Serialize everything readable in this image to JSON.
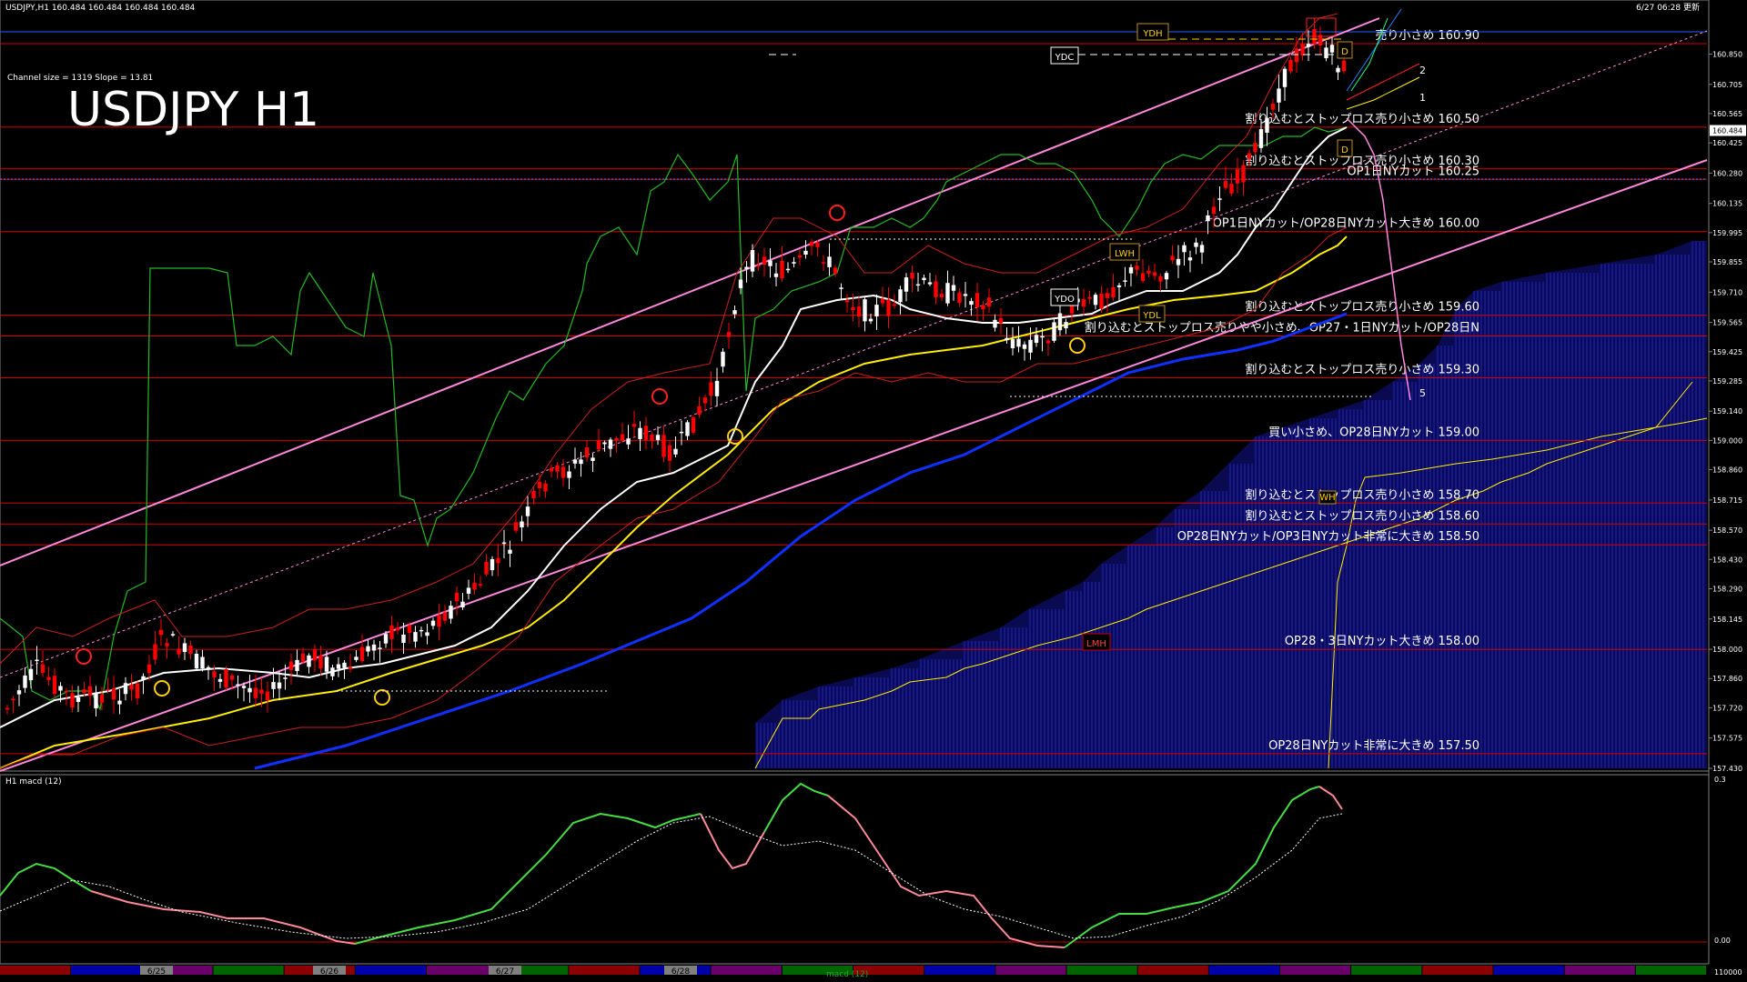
{
  "window": {
    "header": "USDJPY,H1  160.484 160.484 160.484 160.484",
    "updated": "6/27 06:28 更新",
    "symbol_title": "USDJPY H1",
    "channel_info": "Channel size = 1319  Slope = 13.81",
    "sub_label": "H1  macd (12)",
    "bottom_status": "macd (12)"
  },
  "colors": {
    "background": "#000000",
    "bull": "#ffffff",
    "bear": "#ff0000",
    "level_line": "#d40000",
    "channel": "#ff88dd",
    "macd_up": "#44dd44",
    "macd_down": "#ff8899",
    "kumo": "#2020c0",
    "ma_yellow": "#ffee00",
    "ma_blue": "#1030ff",
    "ma_white": "#ffffff",
    "green_line": "#22bb22"
  },
  "chart_data": {
    "type": "candlestick",
    "symbol": "USDJPY",
    "timeframe": "H1",
    "ylim": [
      157.43,
      161.0
    ],
    "y_ticks": [
      "160.850",
      "160.705",
      "160.565",
      "160.425",
      "160.280",
      "160.135",
      "159.995",
      "159.855",
      "159.710",
      "159.565",
      "159.425",
      "159.285",
      "159.140",
      "159.000",
      "158.860",
      "158.715",
      "158.570",
      "158.430",
      "158.290",
      "158.145",
      "158.000",
      "157.860",
      "157.720",
      "157.575",
      "157.430"
    ],
    "current_price": "160.484",
    "date_labels": [
      "6/25",
      "6/26",
      "6/27",
      "6/28"
    ],
    "levels": [
      {
        "price": 160.9,
        "label": "売り小さめ 160.90"
      },
      {
        "price": 160.5,
        "label": "割り込むとストップロス売り小さめ 160.50"
      },
      {
        "price": 160.3,
        "label": "割り込むとストップロス売り小さめ 160.30"
      },
      {
        "price": 160.25,
        "label": "OP1日NYカット 160.25"
      },
      {
        "price": 160.0,
        "label": "OP1日NYカット/OP28日NYカット大きめ 160.00"
      },
      {
        "price": 159.6,
        "label": "割り込むとストップロス売り小さめ 159.60"
      },
      {
        "price": 159.5,
        "label": "割り込むとストップロス売りやや小さめ、OP27・1日NYカット/OP28日N"
      },
      {
        "price": 159.3,
        "label": "割り込むとストップロス売り小さめ 159.30"
      },
      {
        "price": 159.0,
        "label": "買い小さめ、OP28日NYカット 159.00"
      },
      {
        "price": 158.7,
        "label": "割り込むとストップロス売り小さめ 158.70"
      },
      {
        "price": 158.6,
        "label": "割り込むとストップロス売り小さめ 158.60"
      },
      {
        "price": 158.5,
        "label": "OP28日NYカット/OP3日NYカット非常に大きめ 158.50"
      },
      {
        "price": 158.0,
        "label": "OP28・3日NYカット大きめ 158.00"
      },
      {
        "price": 157.5,
        "label": "OP28日NYカット非常に大きめ 157.50"
      }
    ],
    "markers": [
      "YDH",
      "YDC",
      "YDO",
      "YDL",
      "LWH",
      "LMH",
      "WH",
      "D",
      "1",
      "2",
      "5"
    ],
    "macd_ticks": [
      "0.3",
      "0.00",
      "110000"
    ]
  }
}
